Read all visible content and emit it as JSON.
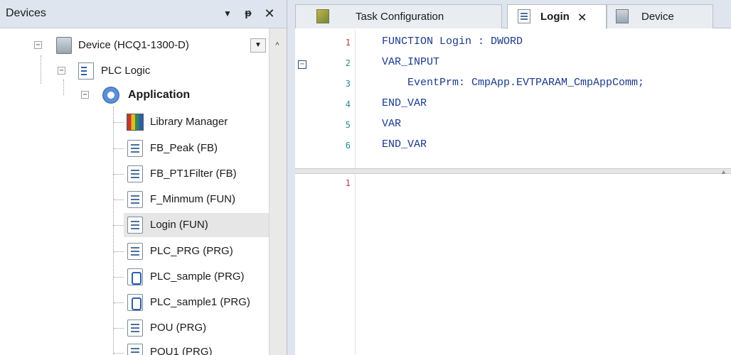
{
  "devices_panel": {
    "title": "Devices",
    "dropdown_icon": "▼",
    "pin_icon": "ᵽ",
    "close_icon": "✕",
    "combo_arrow": "▼",
    "scroll_up": "^"
  },
  "tree": {
    "device": "Device (HCQ1-1300-D)",
    "plc_logic": "PLC Logic",
    "application": "Application",
    "items": [
      {
        "label": "Library Manager",
        "icon": "library-icon"
      },
      {
        "label": "FB_Peak (FB)",
        "icon": "pou-icon"
      },
      {
        "label": "FB_PT1Filter (FB)",
        "icon": "pou-icon"
      },
      {
        "label": "F_Minmum (FUN)",
        "icon": "pou-icon"
      },
      {
        "label": "Login (FUN)",
        "icon": "pou-icon",
        "selected": true
      },
      {
        "label": "PLC_PRG (PRG)",
        "icon": "pou-icon"
      },
      {
        "label": "PLC_sample (PRG)",
        "icon": "program-icon"
      },
      {
        "label": "PLC_sample1 (PRG)",
        "icon": "program-icon"
      },
      {
        "label": "POU (PRG)",
        "icon": "pou-icon"
      },
      {
        "label": "POU1 (PRG)",
        "icon": "pou-icon"
      }
    ]
  },
  "editor": {
    "tabs": [
      {
        "label": "Task Configuration",
        "icon": "task-icon",
        "active": false
      },
      {
        "label": "Login",
        "icon": "pou-icon",
        "active": true,
        "close": "✕"
      },
      {
        "label": "Device",
        "icon": "device-icon",
        "active": false
      }
    ],
    "fold_symbol": "⊟",
    "declaration": {
      "line_numbers": [
        "1",
        "2",
        "3",
        "4",
        "5",
        "6"
      ],
      "lines": [
        "FUNCTION Login : DWORD",
        "VAR_INPUT",
        "    EventPrm: CmpApp.EVTPARAM_CmpAppComm;",
        "END_VAR",
        "VAR",
        "END_VAR"
      ]
    },
    "implementation": {
      "line_numbers": [
        "1"
      ]
    },
    "splitter_arrow": "▲"
  },
  "colors": {
    "panel_header": "#dfe5ee",
    "keyword_blue": "#1a3a8a",
    "line_number_teal": "#2a8b8b",
    "selection_gray": "#e6e6e6"
  }
}
